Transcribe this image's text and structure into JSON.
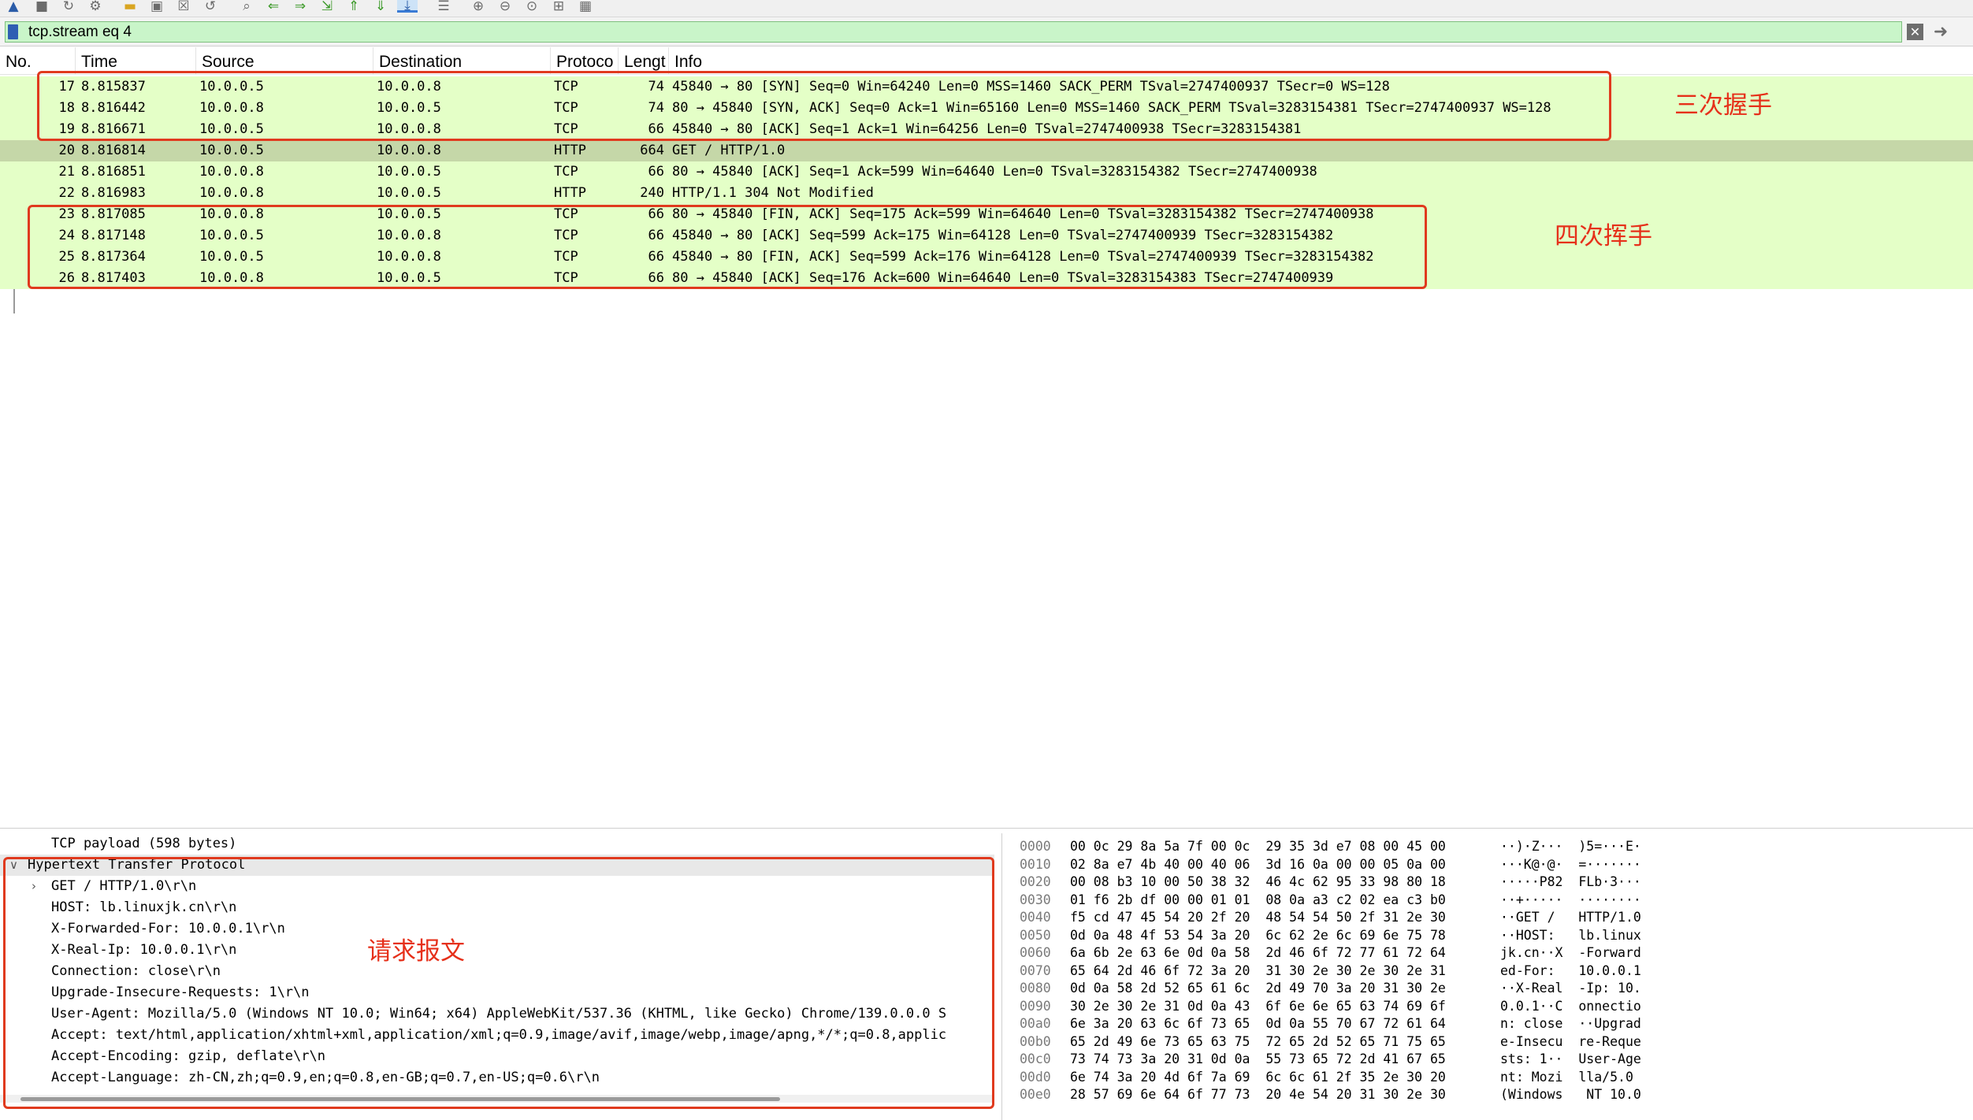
{
  "toolbar": {
    "icons": [
      "shark-fin-start-icon",
      "stop-capture-icon",
      "restart-capture-icon",
      "capture-options-icon",
      "open-file-icon",
      "save-file-icon",
      "close-file-icon",
      "reload-icon",
      "find-packet-icon",
      "go-back-icon",
      "go-forward-icon",
      "go-to-packet-icon",
      "first-packet-icon",
      "last-packet-icon",
      "autoscroll-icon",
      "colorize-icon",
      "zoom-in-icon",
      "zoom-out-icon",
      "normal-size-icon",
      "resize-columns-icon",
      "layout-icon"
    ]
  },
  "filter": {
    "value": "tcp.stream eq 4"
  },
  "packet_list": {
    "columns": [
      "No.",
      "Time",
      "Source",
      "Destination",
      "Protoco",
      "Lengt",
      "Info"
    ],
    "rows": [
      {
        "no": "17",
        "time": "8.815837",
        "src": "10.0.0.5",
        "dst": "10.0.0.8",
        "proto": "TCP",
        "len": "74",
        "info": "45840 → 80 [SYN] Seq=0 Win=64240 Len=0 MSS=1460 SACK_PERM TSval=2747400937 TSecr=0 WS=128"
      },
      {
        "no": "18",
        "time": "8.816442",
        "src": "10.0.0.8",
        "dst": "10.0.0.5",
        "proto": "TCP",
        "len": "74",
        "info": "80 → 45840 [SYN, ACK] Seq=0 Ack=1 Win=65160 Len=0 MSS=1460 SACK_PERM TSval=3283154381 TSecr=2747400937 WS=128"
      },
      {
        "no": "19",
        "time": "8.816671",
        "src": "10.0.0.5",
        "dst": "10.0.0.8",
        "proto": "TCP",
        "len": "66",
        "info": "45840 → 80 [ACK] Seq=1 Ack=1 Win=64256 Len=0 TSval=2747400938 TSecr=3283154381"
      },
      {
        "no": "20",
        "time": "8.816814",
        "src": "10.0.0.5",
        "dst": "10.0.0.8",
        "proto": "HTTP",
        "len": "664",
        "info": "GET / HTTP/1.0"
      },
      {
        "no": "21",
        "time": "8.816851",
        "src": "10.0.0.8",
        "dst": "10.0.0.5",
        "proto": "TCP",
        "len": "66",
        "info": "80 → 45840 [ACK] Seq=1 Ack=599 Win=64640 Len=0 TSval=3283154382 TSecr=2747400938"
      },
      {
        "no": "22",
        "time": "8.816983",
        "src": "10.0.0.8",
        "dst": "10.0.0.5",
        "proto": "HTTP",
        "len": "240",
        "info": "HTTP/1.1 304 Not Modified"
      },
      {
        "no": "23",
        "time": "8.817085",
        "src": "10.0.0.8",
        "dst": "10.0.0.5",
        "proto": "TCP",
        "len": "66",
        "info": "80 → 45840 [FIN, ACK] Seq=175 Ack=599 Win=64640 Len=0 TSval=3283154382 TSecr=2747400938"
      },
      {
        "no": "24",
        "time": "8.817148",
        "src": "10.0.0.5",
        "dst": "10.0.0.8",
        "proto": "TCP",
        "len": "66",
        "info": "45840 → 80 [ACK] Seq=599 Ack=175 Win=64128 Len=0 TSval=2747400939 TSecr=3283154382"
      },
      {
        "no": "25",
        "time": "8.817364",
        "src": "10.0.0.5",
        "dst": "10.0.0.8",
        "proto": "TCP",
        "len": "66",
        "info": "45840 → 80 [FIN, ACK] Seq=599 Ack=176 Win=64128 Len=0 TSval=2747400939 TSecr=3283154382"
      },
      {
        "no": "26",
        "time": "8.817403",
        "src": "10.0.0.8",
        "dst": "10.0.0.5",
        "proto": "TCP",
        "len": "66",
        "info": "80 → 45840 [ACK] Seq=176 Ack=600 Win=64640 Len=0 TSval=3283154383 TSecr=2747400939"
      }
    ],
    "selected_no": "20"
  },
  "details": {
    "lines": [
      {
        "text": "TCP payload (598 bytes)",
        "indent": 2,
        "expander": ""
      },
      {
        "text": "Hypertext Transfer Protocol",
        "indent": 1,
        "expander": "∨"
      },
      {
        "text": "GET / HTTP/1.0\\r\\n",
        "indent": 2,
        "expander": "›"
      },
      {
        "text": "HOST: lb.linuxjk.cn\\r\\n",
        "indent": 2,
        "expander": ""
      },
      {
        "text": "X-Forwarded-For: 10.0.0.1\\r\\n",
        "indent": 2,
        "expander": ""
      },
      {
        "text": "X-Real-Ip: 10.0.0.1\\r\\n",
        "indent": 2,
        "expander": ""
      },
      {
        "text": "Connection: close\\r\\n",
        "indent": 2,
        "expander": ""
      },
      {
        "text": "Upgrade-Insecure-Requests: 1\\r\\n",
        "indent": 2,
        "expander": ""
      },
      {
        "text": "User-Agent: Mozilla/5.0 (Windows NT 10.0; Win64; x64) AppleWebKit/537.36 (KHTML, like Gecko) Chrome/139.0.0.0 S",
        "indent": 2,
        "expander": ""
      },
      {
        "text": "Accept: text/html,application/xhtml+xml,application/xml;q=0.9,image/avif,image/webp,image/apng,*/*;q=0.8,applic",
        "indent": 2,
        "expander": ""
      },
      {
        "text": "Accept-Encoding: gzip, deflate\\r\\n",
        "indent": 2,
        "expander": ""
      },
      {
        "text": "Accept-Language: zh-CN,zh;q=0.9,en;q=0.8,en-GB;q=0.7,en-US;q=0.6\\r\\n",
        "indent": 2,
        "expander": ""
      }
    ]
  },
  "bytes": {
    "lines": [
      {
        "offset": "0000",
        "hex": "00 0c 29 8a 5a 7f 00 0c  29 35 3d e7 08 00 45 00",
        "ascii": "··)·Z···  )5=···E·"
      },
      {
        "offset": "0010",
        "hex": "02 8a e7 4b 40 00 40 06  3d 16 0a 00 00 05 0a 00",
        "ascii": "···K@·@·  =·······"
      },
      {
        "offset": "0020",
        "hex": "00 08 b3 10 00 50 38 32  46 4c 62 95 33 98 80 18",
        "ascii": "·····P82  FLb·3···"
      },
      {
        "offset": "0030",
        "hex": "01 f6 2b df 00 00 01 01  08 0a a3 c2 02 ea c3 b0",
        "ascii": "··+·····  ········"
      },
      {
        "offset": "0040",
        "hex": "f5 cd 47 45 54 20 2f 20  48 54 54 50 2f 31 2e 30",
        "ascii": "··GET /   HTTP/1.0"
      },
      {
        "offset": "0050",
        "hex": "0d 0a 48 4f 53 54 3a 20  6c 62 2e 6c 69 6e 75 78",
        "ascii": "··HOST:   lb.linux"
      },
      {
        "offset": "0060",
        "hex": "6a 6b 2e 63 6e 0d 0a 58  2d 46 6f 72 77 61 72 64",
        "ascii": "jk.cn··X  -Forward"
      },
      {
        "offset": "0070",
        "hex": "65 64 2d 46 6f 72 3a 20  31 30 2e 30 2e 30 2e 31",
        "ascii": "ed-For:   10.0.0.1"
      },
      {
        "offset": "0080",
        "hex": "0d 0a 58 2d 52 65 61 6c  2d 49 70 3a 20 31 30 2e",
        "ascii": "··X-Real  -Ip: 10."
      },
      {
        "offset": "0090",
        "hex": "30 2e 30 2e 31 0d 0a 43  6f 6e 6e 65 63 74 69 6f",
        "ascii": "0.0.1··C  onnectio"
      },
      {
        "offset": "00a0",
        "hex": "6e 3a 20 63 6c 6f 73 65  0d 0a 55 70 67 72 61 64",
        "ascii": "n: close  ··Upgrad"
      },
      {
        "offset": "00b0",
        "hex": "65 2d 49 6e 73 65 63 75  72 65 2d 52 65 71 75 65",
        "ascii": "e-Insecu  re-Reque"
      },
      {
        "offset": "00c0",
        "hex": "73 74 73 3a 20 31 0d 0a  55 73 65 72 2d 41 67 65",
        "ascii": "sts: 1··  User-Age"
      },
      {
        "offset": "00d0",
        "hex": "6e 74 3a 20 4d 6f 7a 69  6c 6c 61 2f 35 2e 30 20",
        "ascii": "nt: Mozi  lla/5.0 "
      },
      {
        "offset": "00e0",
        "hex": "28 57 69 6e 64 6f 77 73  20 4e 54 20 31 30 2e 30",
        "ascii": "(Windows   NT 10.0"
      }
    ]
  },
  "annotations": {
    "handshake": "三次握手",
    "teardown": "四次挥手",
    "request": "请求报文",
    "color": "#e6301a"
  }
}
